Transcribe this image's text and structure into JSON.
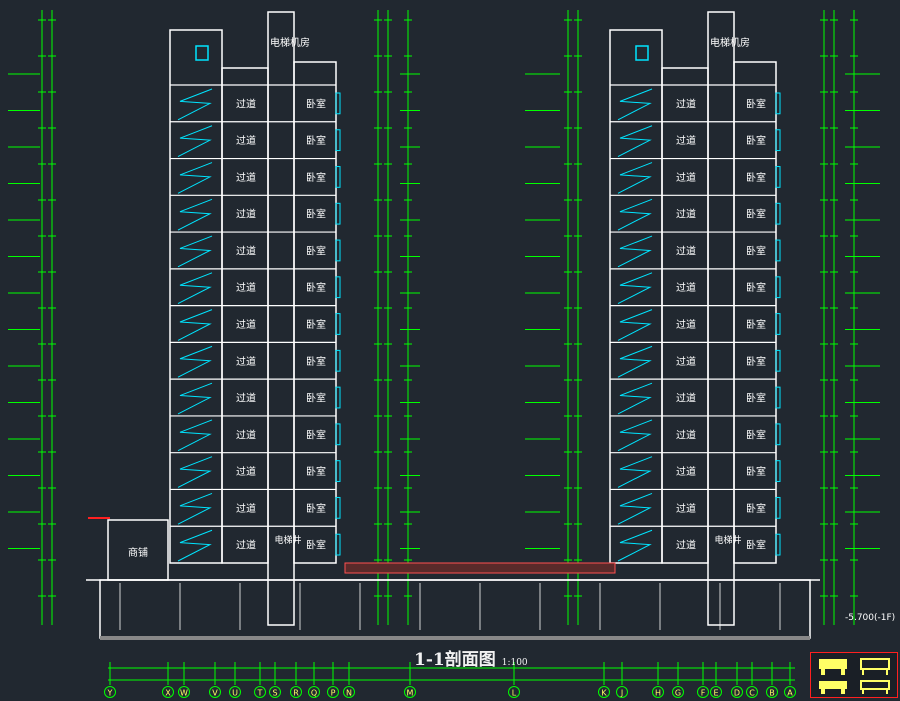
{
  "drawing": {
    "title": "1-1剖面图",
    "scale": "1:100",
    "room_labels": {
      "corridor": "过道",
      "bedroom": "卧室",
      "elevator_room": "电梯机房",
      "elevator_shaft": "电梯井",
      "shop": "商铺"
    },
    "elevation_right_outer": "-5.700(-1F)",
    "axis_labels": [
      "Y",
      "X",
      "W",
      "V",
      "U",
      "T",
      "S",
      "R",
      "Q",
      "P",
      "N",
      "M",
      "L",
      "K",
      "J",
      "H",
      "G",
      "F",
      "E",
      "D",
      "C",
      "B",
      "A"
    ],
    "floors_per_tower": 13,
    "colors": {
      "background": "#212830",
      "wall": "#ffffff",
      "stair": "#00e5ff",
      "dimension": "#00ff00",
      "text": "#ffff66",
      "accent": "#ff2020"
    }
  }
}
